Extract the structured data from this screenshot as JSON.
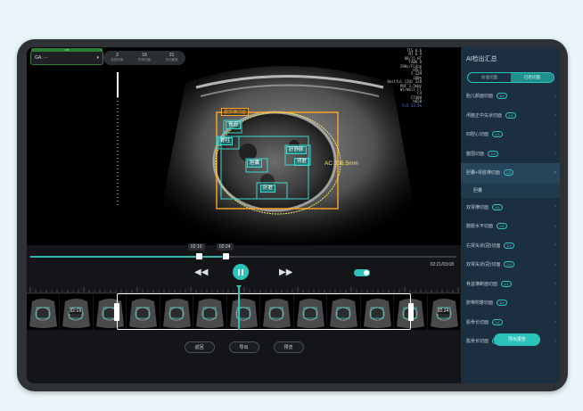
{
  "patient": {
    "ga_label": "GA: - -",
    "tag": "1/5"
  },
  "stats": [
    {
      "value": "3",
      "label": "检查切面"
    },
    {
      "value": "18",
      "label": "异常切面"
    },
    {
      "value": "21",
      "label": "总切面数"
    }
  ],
  "image_params": [
    "TIS 0.6",
    "MI 0.9",
    "88/15 HT",
    "TAB6 D",
    "29Hz/FL4cm",
    "H5L5",
    "5-12M",
    "100%",
    "Restful 17Hz 32B",
    "PRF 3.5kHz",
    "Wl/Wall Fl",
    "C4",
    "CT400",
    "HG50",
    "Fc5 23.5%"
  ],
  "frame_tag": "腹部横切面",
  "structure_labels": [
    "胃泡",
    "脊柱",
    "脐静脉",
    "胆囊",
    "肝脏",
    "肾脏"
  ],
  "measurement": "AC 206.5mm",
  "playback": {
    "bubble_left": "02:10",
    "bubble_right": "02:24",
    "timecode": "02:21/03:08",
    "progress": 0.45
  },
  "thumbnails": [
    {
      "time": ""
    },
    {
      "time": "02:19"
    },
    {
      "time": ""
    },
    {
      "time": ""
    },
    {
      "time": ""
    },
    {
      "time": ""
    },
    {
      "time": ""
    },
    {
      "time": ""
    },
    {
      "time": ""
    },
    {
      "time": ""
    },
    {
      "time": ""
    },
    {
      "time": ""
    },
    {
      "time": "02:24"
    }
  ],
  "actions": {
    "cancel": "返回",
    "export": "导出",
    "preview": "预览"
  },
  "sidebar": {
    "title": "AI检出汇总",
    "tabs": [
      "标准切面",
      "已检切面"
    ],
    "items": [
      {
        "label": "胎儿颜面切面",
        "count": "1/4"
      },
      {
        "label": "颅脑正中矢状切面",
        "count": "1/4"
      },
      {
        "label": "四腔心切面",
        "count": "1/4"
      },
      {
        "label": "腹围切面",
        "count": "1/4"
      },
      {
        "label": "胆囊+肾脏横切面",
        "count": "1/4"
      },
      {
        "label": "胆囊",
        "count": ""
      },
      {
        "label": "双肾横切面",
        "count": "1/4"
      },
      {
        "label": "膀胱水平切面",
        "count": "1/4"
      },
      {
        "label": "右肾矢状(冠)切面",
        "count": "1/4"
      },
      {
        "label": "双肾矢状(冠)切面",
        "count": "1/4"
      },
      {
        "label": "骨盆横断面切面",
        "count": "1/4"
      },
      {
        "label": "脐带附着切面",
        "count": "1/4"
      },
      {
        "label": "股骨长切面",
        "count": "1/4"
      },
      {
        "label": "肱骨长切面",
        "count": "1/4"
      }
    ],
    "export_button": "导出报告"
  },
  "colors": {
    "accent": "#2cc3bd",
    "frame": "#ffa726",
    "sidebar_bg": "#1c2f40"
  }
}
